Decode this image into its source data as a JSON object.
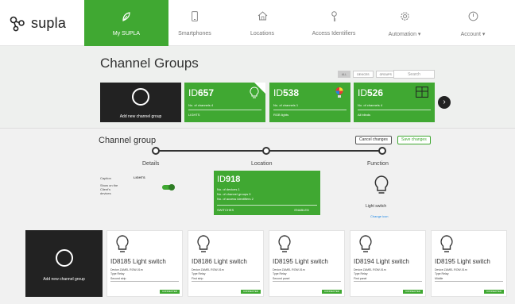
{
  "app": {
    "logo_text": "supla"
  },
  "nav": {
    "items": [
      {
        "label": "My SUPLA",
        "icon": "supla-leaf-icon",
        "active": true
      },
      {
        "label": "Smartphones",
        "icon": "smartphone-icon"
      },
      {
        "label": "Locations",
        "icon": "home-icon"
      },
      {
        "label": "Access Identifiers",
        "icon": "key-icon"
      },
      {
        "label": "Automation ▾",
        "icon": "gear-icon"
      },
      {
        "label": "Account ▾",
        "icon": "power-icon"
      }
    ]
  },
  "channel_groups": {
    "title": "Channel Groups",
    "filters": [
      "ALL",
      "DEVICES",
      "GROUPS"
    ],
    "search_placeholder": "Search",
    "add_label": "Add new channel group",
    "cards": [
      {
        "id_prefix": "ID",
        "id": "657",
        "channels": "No. of channels 4",
        "name": "LIGHTS",
        "icon": "bulb-icon",
        "selected": true
      },
      {
        "id_prefix": "ID",
        "id": "538",
        "channels": "No. of channels 1",
        "name": "RGB lights",
        "icon": "rgb-bulb-icon",
        "selected": false
      },
      {
        "id_prefix": "ID",
        "id": "526",
        "channels": "No. of channels 4",
        "name": "All blinds",
        "icon": "blinds-icon",
        "selected": false
      }
    ]
  },
  "editor": {
    "title": "Channel group",
    "cancel_label": "Cancel changes",
    "save_label": "Save changes",
    "steps": [
      "Details",
      "Location",
      "Function"
    ],
    "caption_label": "Caption",
    "caption_value": "LIGHTS",
    "show_label_1": "Show on the",
    "show_label_2": "Client's",
    "show_label_3": "devices",
    "location": {
      "id_prefix": "ID",
      "id": "918",
      "line1": "No. of devices 1",
      "line2": "No. of channel groups 0",
      "line3": "No. of access identifiers 2",
      "name": "SWITCHES",
      "badge": "ENABLED"
    },
    "function_label": "Light switch",
    "function_change": "Change icon"
  },
  "channels": {
    "add_label": "Add new channel group",
    "cards": [
      {
        "title": "ID8185 Light switch",
        "device": "Device ZAMEL ROW-01m",
        "type": "Type Relay",
        "caption": "Second strip",
        "badge": "CONNECTED"
      },
      {
        "title": "ID8186 Light switch",
        "device": "Device ZAMEL ROW-01m",
        "type": "Type Relay",
        "caption": "First strip",
        "badge": "CONNECTED"
      },
      {
        "title": "ID8195 Light switch",
        "device": "Device ZAMEL ROW-01m",
        "type": "Type Relay",
        "caption": "Second panel",
        "badge": "CONNECTED"
      },
      {
        "title": "ID8194 Light switch",
        "device": "Device ZAMEL ROW-01m",
        "type": "Type Relay",
        "caption": "First panel",
        "badge": "CONNECTED"
      },
      {
        "title": "ID8195 Light switch",
        "device": "Device ZAMEL ROW-01m",
        "type": "Type Relay",
        "caption": "Middle",
        "badge": "CONNECTED"
      }
    ]
  },
  "colors": {
    "brand_green": "#40a832",
    "dark": "#222222"
  }
}
